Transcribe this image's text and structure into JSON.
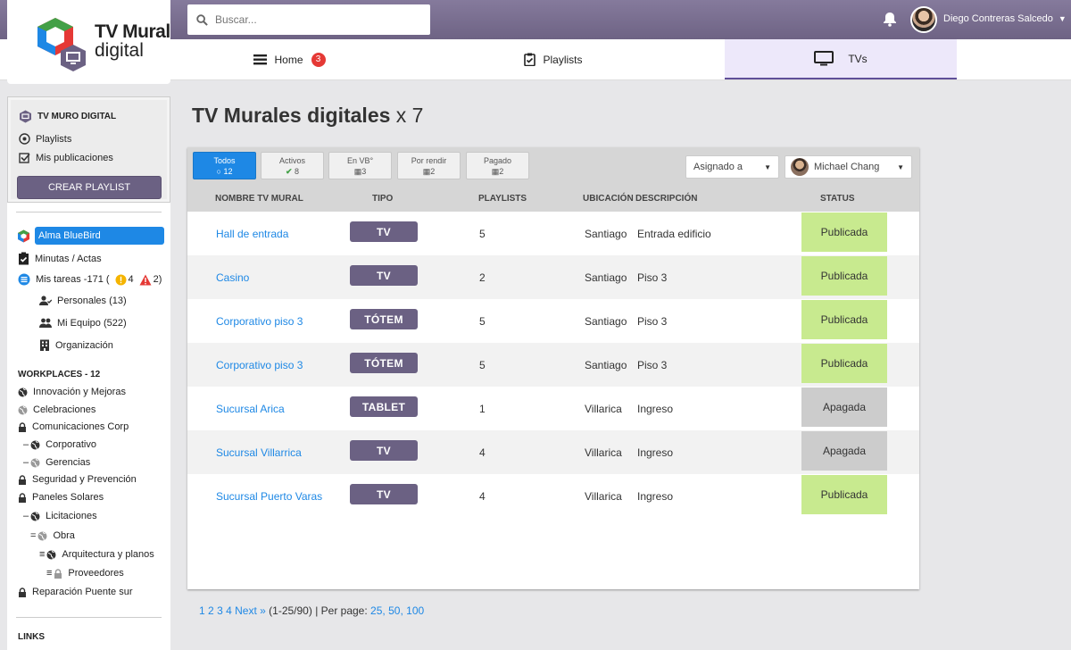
{
  "app": {
    "logo_title": "TV Mural",
    "logo_sub": "digital"
  },
  "search": {
    "placeholder": "Buscar..."
  },
  "user": {
    "name": "Diego Contreras Salcedo"
  },
  "nav": {
    "home_label": "Home",
    "home_badge": "3",
    "playlists_label": "Playlists",
    "tvs_label": "TVs"
  },
  "sidebar": {
    "card_title": "TV MURO DIGITAL",
    "playlists": "Playlists",
    "mis_publicaciones": "Mis publicaciones",
    "crear_playlist": "CREAR PLAYLIST",
    "org": "Alma BlueBird",
    "minutas": "Minutas / Actas",
    "mis_tareas": "Mis tareas -171 (",
    "tareas_warn": "4",
    "tareas_alert": "2)",
    "personales": "Personales (13)",
    "mi_equipo": "Mi Equipo (522)",
    "organizacion": "Organización",
    "workplaces_title": "WORKPLACES - 12",
    "workplaces": [
      {
        "prefix": "",
        "label": "Innovación y Mejoras",
        "icon": "globe-icon"
      },
      {
        "prefix": "",
        "label": "Celebraciones",
        "icon": "globe-icon"
      },
      {
        "prefix": "",
        "label": "Comunicaciones Corp",
        "icon": "lock-icon"
      },
      {
        "prefix": "–",
        "label": "Corporativo",
        "icon": "globe-icon"
      },
      {
        "prefix": "–",
        "label": "Gerencias",
        "icon": "globe-icon"
      },
      {
        "prefix": "",
        "label": "Seguridad y Prevención",
        "icon": "lock-icon"
      },
      {
        "prefix": "",
        "label": "Paneles Solares",
        "icon": "lock-icon"
      },
      {
        "prefix": "–",
        "label": "Licitaciones",
        "icon": "globe-icon"
      },
      {
        "prefix": "=",
        "label": "Obra",
        "icon": "globe-icon"
      },
      {
        "prefix": "≡",
        "label": "Arquitectura y planos",
        "icon": "globe-icon"
      },
      {
        "prefix": "≡",
        "label": "Proveedores",
        "icon": "lock-icon"
      },
      {
        "prefix": "",
        "label": "Reparación Puente sur",
        "icon": "lock-icon"
      }
    ],
    "links_title": "LINKS"
  },
  "main": {
    "title": "TV Murales digitales",
    "count": "x 7",
    "filters": [
      {
        "label": "Todos",
        "count": "12"
      },
      {
        "label": "Activos",
        "count": "8"
      },
      {
        "label": "En VB°",
        "count": "3"
      },
      {
        "label": "Por rendir",
        "count": "2"
      },
      {
        "label": "Pagado",
        "count": "2"
      }
    ],
    "assigned_label": "Asignado a",
    "assigned_user": "Michael Chang",
    "columns": [
      "NOMBRE TV MURAL",
      "TIPO",
      "PLAYLISTS",
      "UBICACIÓN",
      "DESCRIPCIÓN",
      "STATUS"
    ],
    "rows": [
      {
        "name": "Hall de entrada",
        "tipo": "TV",
        "playlists": "5",
        "ubicacion": "Santiago",
        "descripcion": "Entrada edificio",
        "status": "Publicada"
      },
      {
        "name": "Casino",
        "tipo": "TV",
        "playlists": "2",
        "ubicacion": "Santiago",
        "descripcion": "Piso 3",
        "status": "Publicada"
      },
      {
        "name": "Corporativo piso 3",
        "tipo": "TÓTEM",
        "playlists": "5",
        "ubicacion": "Santiago",
        "descripcion": "Piso 3",
        "status": "Publicada"
      },
      {
        "name": "Corporativo piso 3",
        "tipo": "TÓTEM",
        "playlists": "5",
        "ubicacion": "Santiago",
        "descripcion": "Piso 3",
        "status": "Publicada"
      },
      {
        "name": "Sucursal Arica",
        "tipo": "TABLET",
        "playlists": "1",
        "ubicacion": "Villarica",
        "descripcion": "Ingreso",
        "status": "Apagada"
      },
      {
        "name": "Sucursal Villarrica",
        "tipo": "TV",
        "playlists": "4",
        "ubicacion": "Villarica",
        "descripcion": "Ingreso",
        "status": "Apagada"
      },
      {
        "name": "Sucursal Puerto Varas",
        "tipo": "TV",
        "playlists": "4",
        "ubicacion": "Villarica",
        "descripcion": "Ingreso",
        "status": "Publicada"
      }
    ],
    "status_colors": {
      "Publicada": "#c8ea8f",
      "Apagada": "#cccccc"
    }
  },
  "pager": {
    "pages": [
      "1",
      "2",
      "3",
      "4"
    ],
    "next": "Next »",
    "range": "(1-25/90)",
    "per_page_label": "| Per page:",
    "per_page": [
      "25",
      "50",
      "100"
    ]
  }
}
